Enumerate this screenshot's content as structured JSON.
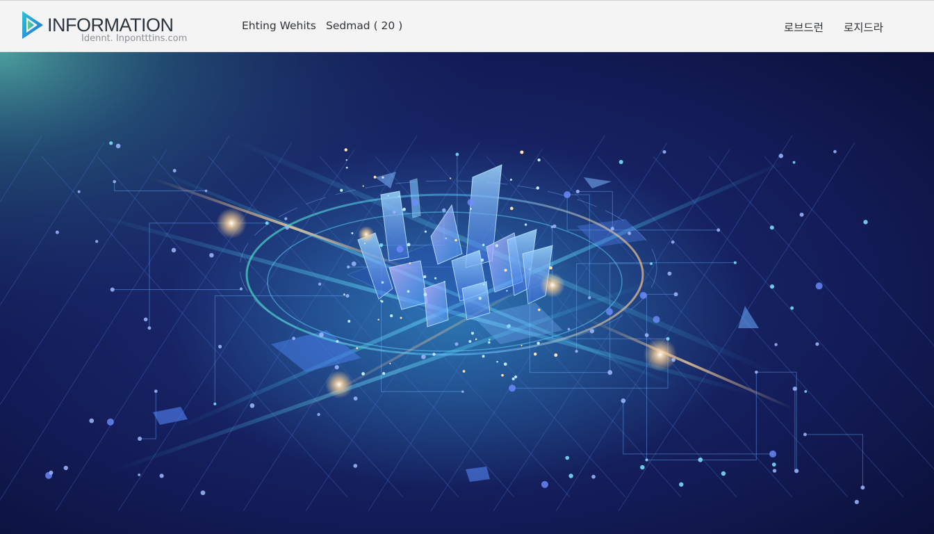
{
  "header": {
    "logo": {
      "title": "INFORMATION",
      "subtitle": "Idennt. Inpontttins.com",
      "icon": "play-triangle-logo-icon"
    },
    "nav_left": [
      {
        "label": "Ehting Wehits"
      },
      {
        "label": "Sedmad ( 20 )"
      }
    ],
    "nav_right": [
      {
        "label": "로브드런"
      },
      {
        "label": "로지드라"
      }
    ]
  },
  "hero": {
    "illustration": "isometric-data-network-illustration",
    "colors": {
      "background_dark": "#0b0f3a",
      "background_mid": "#1a2a6e",
      "teal_glow": "#4fa7a3",
      "cyan_accent": "#3fd0ff",
      "crystal_blue": "#7fc6ff",
      "warm_flare": "#ffd59a"
    }
  }
}
